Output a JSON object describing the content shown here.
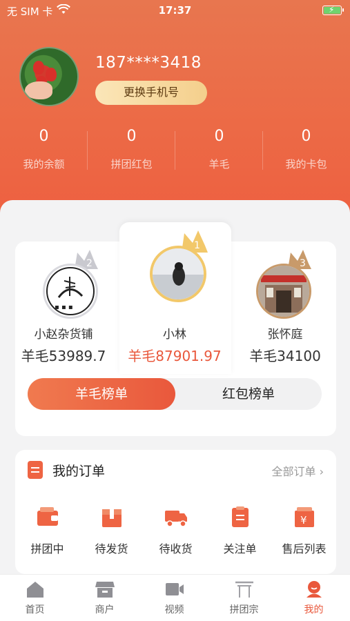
{
  "status_bar": {
    "carrier": "无 SIM 卡",
    "time": "17:37"
  },
  "profile": {
    "phone": "187****3418",
    "change_phone_label": "更换手机号"
  },
  "stats": [
    {
      "value": "0",
      "label": "我的余额"
    },
    {
      "value": "0",
      "label": "拼团红包"
    },
    {
      "value": "0",
      "label": "羊毛"
    },
    {
      "value": "0",
      "label": "我的卡包"
    }
  ],
  "ranking": [
    {
      "rank": "2",
      "name": "小赵杂货铺",
      "score": "羊毛53989.7"
    },
    {
      "rank": "1",
      "name": "小林",
      "score": "羊毛87901.97"
    },
    {
      "rank": "3",
      "name": "张怀庭",
      "score": "羊毛34100"
    }
  ],
  "ranking_tabs": {
    "active": "羊毛榜单",
    "inactive": "红包榜单"
  },
  "orders": {
    "title": "我的订单",
    "all_label": "全部订单",
    "items": [
      {
        "label": "拼团中",
        "icon": "wallet-icon"
      },
      {
        "label": "待发货",
        "icon": "gift-box-icon"
      },
      {
        "label": "待收货",
        "icon": "truck-icon"
      },
      {
        "label": "关注单",
        "icon": "clipboard-icon"
      },
      {
        "label": "售后列表",
        "icon": "yen-box-icon"
      }
    ]
  },
  "bottom_nav": [
    {
      "label": "首页",
      "icon": "home-icon"
    },
    {
      "label": "商户",
      "icon": "store-icon"
    },
    {
      "label": "视频",
      "icon": "video-icon"
    },
    {
      "label": "拼团宗",
      "icon": "gate-icon"
    },
    {
      "label": "我的",
      "icon": "profile-icon"
    }
  ],
  "colors": {
    "accent": "#e9583c",
    "gold": "#f2c86a"
  }
}
